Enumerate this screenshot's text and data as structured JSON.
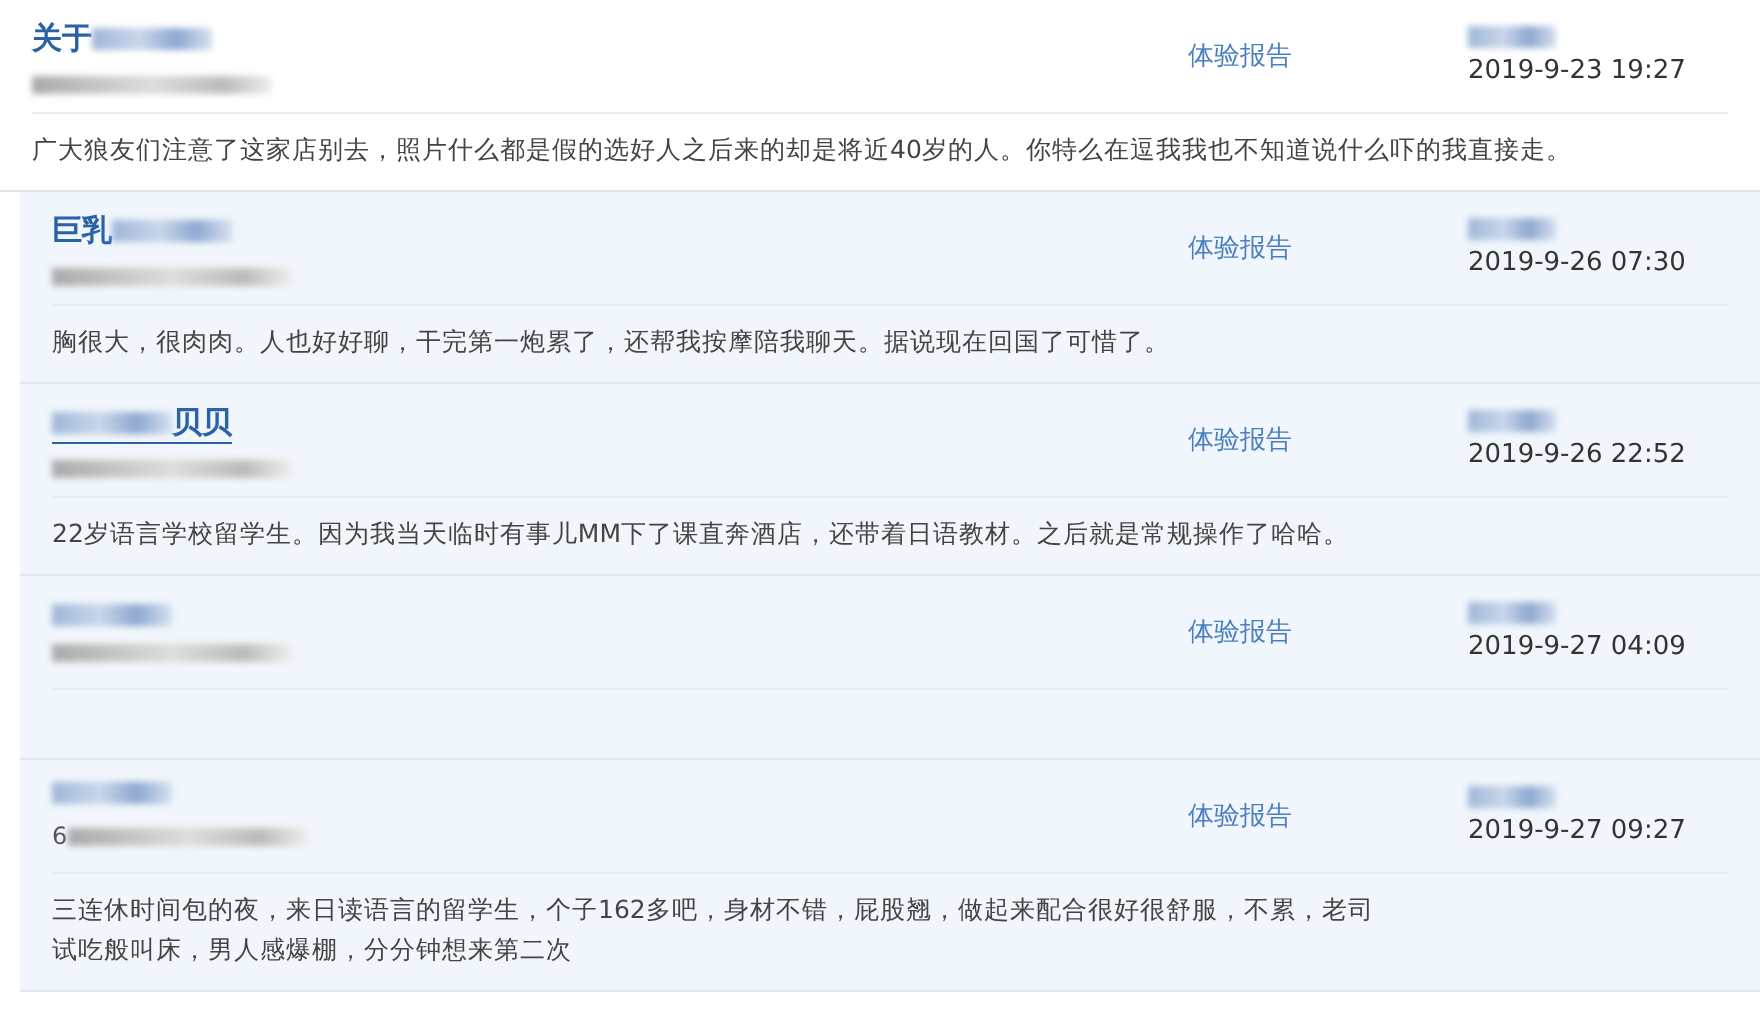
{
  "posts": [
    {
      "title_parts": [
        {
          "kind": "text",
          "text": "关于"
        },
        {
          "kind": "blur"
        }
      ],
      "hovered": false,
      "ip_parts": [
        {
          "kind": "blur"
        }
      ],
      "link": "体验报告",
      "author_parts": [
        {
          "kind": "blur"
        }
      ],
      "date": "2019-9-23 19:27",
      "body": [
        "广大狼友们注意了这家店别去，照片什么都是假的选好人之后来的却是将近40岁的人。你特么在逗我我也不知道说什么吓的我直接走。"
      ]
    },
    {
      "title_parts": [
        {
          "kind": "text",
          "text": "巨乳"
        },
        {
          "kind": "blur"
        }
      ],
      "hovered": false,
      "ip_parts": [
        {
          "kind": "blur"
        }
      ],
      "link": "体验报告",
      "author_parts": [
        {
          "kind": "blur"
        }
      ],
      "date": "2019-9-26 07:30",
      "body": [
        "胸很大，很肉肉。人也好好聊，干完第一炮累了，还帮我按摩陪我聊天。据说现在回国了可惜了。"
      ]
    },
    {
      "title_parts": [
        {
          "kind": "blur"
        },
        {
          "kind": "text",
          "text": "贝贝"
        }
      ],
      "hovered": true,
      "ip_parts": [
        {
          "kind": "blur"
        }
      ],
      "link": "体验报告",
      "author_parts": [
        {
          "kind": "blur"
        }
      ],
      "date": "2019-9-26 22:52",
      "body": [
        "22岁语言学校留学生。因为我当天临时有事儿MM下了课直奔酒店，还带着日语教材。之后就是常规操作了哈哈。"
      ]
    },
    {
      "title_parts": [
        {
          "kind": "blur"
        }
      ],
      "hovered": false,
      "ip_parts": [
        {
          "kind": "blur"
        }
      ],
      "link": "体验报告",
      "author_parts": [
        {
          "kind": "blur"
        }
      ],
      "date": "2019-9-27 04:09"
    },
    {
      "title_parts": [
        {
          "kind": "blur"
        }
      ],
      "hovered": false,
      "ip_parts": [
        {
          "kind": "text",
          "text": "6"
        },
        {
          "kind": "blur"
        }
      ],
      "link": "体验报告",
      "author_parts": [
        {
          "kind": "blur"
        }
      ],
      "date": "2019-9-27 09:27",
      "body": [
        "三连休时间包的夜，来日读语言的留学生，个子162多吧，身材不错，屁股翘，做起来配合很好很舒服，不累，老司",
        "试吃般叫床，男人感爆棚，分分钟想来第二次"
      ]
    }
  ]
}
